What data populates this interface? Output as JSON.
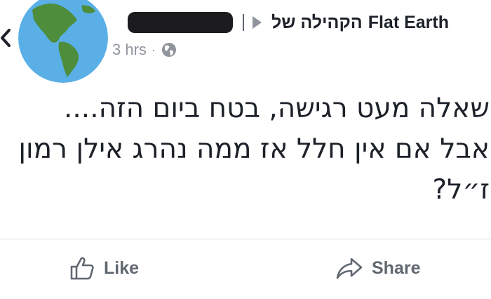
{
  "nav": {
    "back_icon": "chevron-left-icon"
  },
  "post": {
    "author_redacted": true,
    "group_prefix": "הקהילה של",
    "group_name": "Flat Earth",
    "time": "3 hrs",
    "separator": "·",
    "audience_icon": "globe-icon",
    "lines": [
      "שאלה מעט רגישה, בטח ביום הזה....",
      "אבל אם אין חלל אז ממה נהרג אילן רמון",
      "ז״ל?"
    ]
  },
  "actions": {
    "like_label": "Like",
    "share_label": "Share"
  },
  "colors": {
    "text": "#1d2129",
    "muted": "#90949c",
    "action": "#606770",
    "globe_ocean": "#5ab0e6",
    "globe_land": "#4d8d3b"
  }
}
